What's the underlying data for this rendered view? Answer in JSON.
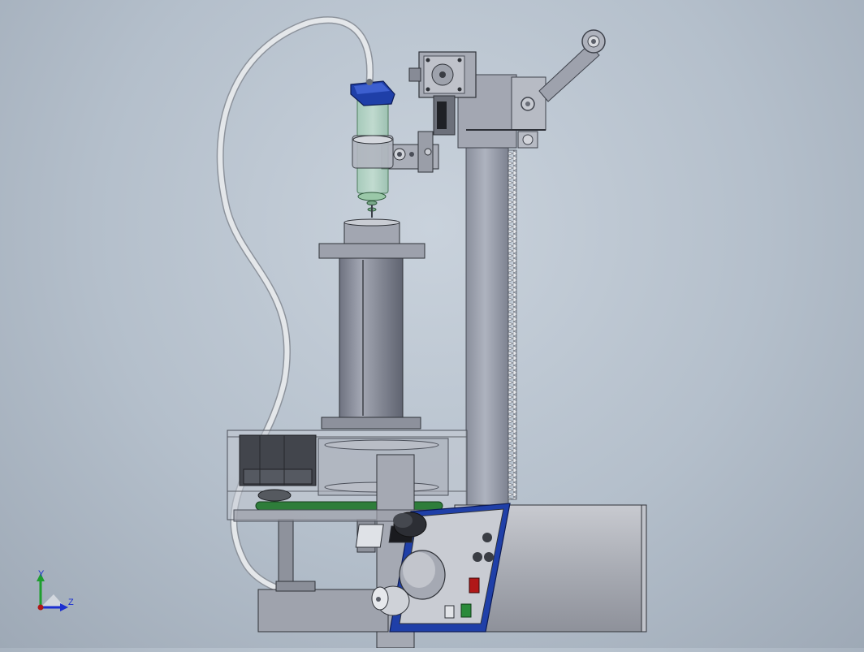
{
  "viewport": {
    "background_top": "#c9d2dc",
    "background_bottom": "#9ea9b6"
  },
  "triad": {
    "y_axis_label": "Y",
    "z_axis_label": "Z",
    "y_axis_color": "#1e9e2e",
    "z_axis_color": "#1b2fd0",
    "origin_color": "#b01818"
  },
  "model": {
    "tube_color": "#d8dce0",
    "blue_accent": "#1f3fa8",
    "green_ring": "#2e7d3a",
    "indicator_red": "#b01818",
    "indicator_green": "#2a8a3a"
  }
}
